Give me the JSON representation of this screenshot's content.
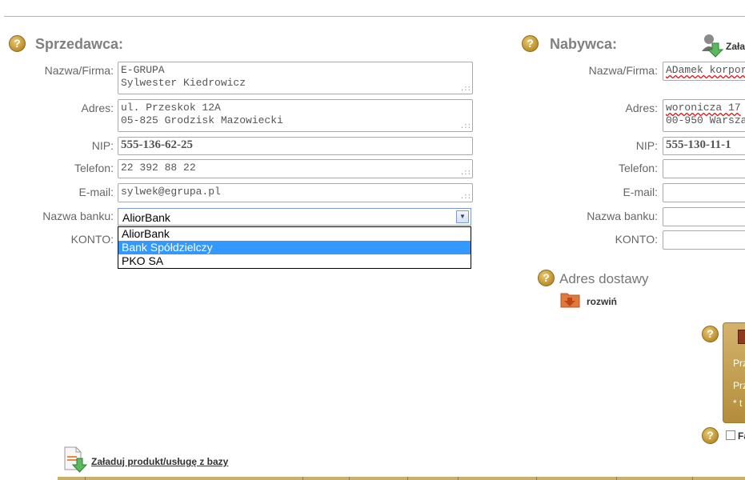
{
  "seller": {
    "title": "Sprzedawca:",
    "labels": {
      "name": "Nazwa/Firma:",
      "address": "Adres:",
      "nip": "NIP:",
      "phone": "Telefon:",
      "email": "E-mail:",
      "bank": "Nazwa banku:",
      "account": "KONTO:"
    },
    "name_line1": "E-GRUPA",
    "name_line2": "Sylwester Kiedrowicz",
    "address_line1": "ul. Przeskok 12A",
    "address_line2": "05-825 Grodzisk Mazowiecki",
    "nip": "555-136-62-25",
    "phone": "22 392 88 22",
    "email": "sylwek@egrupa.pl",
    "bank_selected": "AliorBank",
    "bank_options": [
      "AliorBank",
      "Bank Spółdzielczy",
      "PKO SA"
    ],
    "bank_highlighted_index": 1
  },
  "buyer": {
    "title": "Nabywca:",
    "load_label": "Zała",
    "labels": {
      "name": "Nazwa/Firma:",
      "address": "Adres:",
      "nip": "NIP:",
      "phone": "Telefon:",
      "email": "E-mail:",
      "bank": "Nazwa banku:",
      "account": "KONTO:"
    },
    "name_value": "ADamek korpor",
    "address_line1": "woronicza 17",
    "address_line2": "00-950 Warsza",
    "nip": "555-130-11-1"
  },
  "delivery": {
    "title": "Adres dostawy",
    "expand_label": "rozwiń"
  },
  "side_panel": {
    "line1": "Prz",
    "line2": "Prz",
    "line3": "* t"
  },
  "checkbox_label": "Fa",
  "load_product_label": "Załaduj produkt/usługę z bazy",
  "help_glyph": "?",
  "icons": {
    "help": "help-icon",
    "contacts": "contacts-download-icon",
    "folder": "folder-down-icon",
    "document": "document-download-icon",
    "calculator": "calculator-icon",
    "dropdown_arrow": "chevron-down-icon"
  },
  "colors": {
    "help_gold": "#c79b37",
    "select_highlight": "#3399ff",
    "panel_gold": "#c9a55a"
  }
}
